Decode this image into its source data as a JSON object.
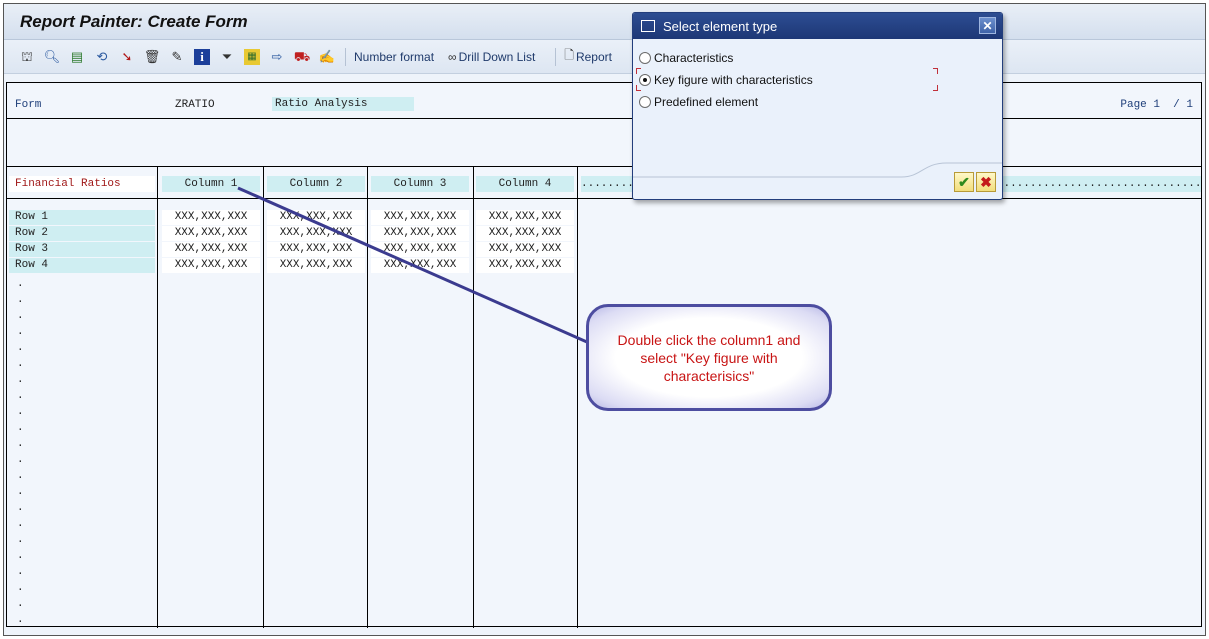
{
  "window": {
    "title": "Report Painter: Create Form"
  },
  "toolbar": {
    "icons": [
      "hierarchy-icon",
      "find-icon",
      "insert-element-icon",
      "undo-icon",
      "select-icon",
      "delete-icon",
      "edit-icon",
      "info-icon",
      "filter-icon",
      "layout-icon",
      "move-icon",
      "transport-icon",
      "text-icon"
    ],
    "number_format": "Number format",
    "drill_down_list": "Drill Down List",
    "report": "Report"
  },
  "form": {
    "label": "Form",
    "id": "ZRATIO",
    "description": "Ratio Analysis",
    "page": "Page 1  / 1",
    "lead_column": "Financial Ratios",
    "columns": [
      "Column 1",
      "Column 2",
      "Column 3",
      "Column 4"
    ],
    "more_columns": "..............................................................................................................................................",
    "rows": [
      {
        "label": "Row 1",
        "values": [
          "XXX,XXX,XXX",
          "XXX,XXX,XXX",
          "XXX,XXX,XXX",
          "XXX,XXX,XXX"
        ]
      },
      {
        "label": "Row 2",
        "values": [
          "XXX,XXX,XXX",
          "XXX,XXX,XXX",
          "XXX,XXX,XXX",
          "XXX,XXX,XXX"
        ]
      },
      {
        "label": "Row 3",
        "values": [
          "XXX,XXX,XXX",
          "XXX,XXX,XXX",
          "XXX,XXX,XXX",
          "XXX,XXX,XXX"
        ]
      },
      {
        "label": "Row 4",
        "values": [
          "XXX,XXX,XXX",
          "XXX,XXX,XXX",
          "XXX,XXX,XXX",
          "XXX,XXX,XXX"
        ]
      }
    ],
    "empty_row_marker": "."
  },
  "dialog": {
    "title": "Select element type",
    "options": [
      {
        "label": "Characteristics",
        "selected": false
      },
      {
        "label": "Key figure with characteristics",
        "selected": true
      },
      {
        "label": "Predefined element",
        "selected": false
      }
    ],
    "confirm_icon": "✔",
    "cancel_icon": "✖",
    "close_icon": "✕"
  },
  "callout": {
    "text": "Double click the column1 and select \"Key figure with characterisics\""
  }
}
